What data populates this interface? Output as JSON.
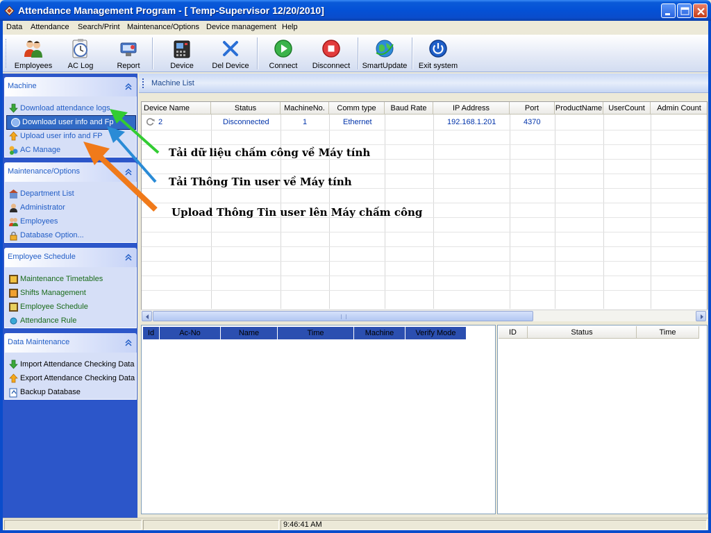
{
  "window": {
    "title": "Attendance Management Program - [ Temp-Supervisor 12/20/2010]",
    "accent": "#0a4ccb"
  },
  "menu": [
    "Data",
    "Attendance",
    "Search/Print",
    "Maintenance/Options",
    "Device management",
    "Help"
  ],
  "toolbar": {
    "employees": "Employees",
    "ac_log": "AC Log",
    "report": "Report",
    "device": "Device",
    "del_device": "Del Device",
    "connect": "Connect",
    "disconnect": "Disconnect",
    "smart_update": "SmartUpdate",
    "exit": "Exit system"
  },
  "sidebar": {
    "machine": {
      "title": "Machine",
      "items": [
        "Download attendance logs",
        "Download user info and Fp",
        "Upload user info and FP",
        "AC Manage"
      ]
    },
    "maintenance": {
      "title": "Maintenance/Options",
      "items": [
        "Department List",
        "Administrator",
        "Employees",
        "Database Option..."
      ]
    },
    "schedule": {
      "title": "Employee Schedule",
      "items": [
        "Maintenance Timetables",
        "Shifts Management",
        "Employee Schedule",
        "Attendance Rule"
      ]
    },
    "data_maint": {
      "title": "Data Maintenance",
      "items": [
        "Import Attendance Checking Data",
        "Export Attendance Checking Data",
        "Backup Database"
      ]
    }
  },
  "machine_list": {
    "title": "Machine List",
    "columns": [
      "Device Name",
      "Status",
      "MachineNo.",
      "Comm type",
      "Baud Rate",
      "IP Address",
      "Port",
      "ProductName",
      "UserCount",
      "Admin Count"
    ],
    "rows": [
      {
        "device_name": "2",
        "status": "Disconnected",
        "machine_no": "1",
        "comm_type": "Ethernet",
        "baud_rate": "",
        "ip": "192.168.1.201",
        "port": "4370",
        "product": "",
        "users": "",
        "admins": ""
      }
    ]
  },
  "log_table": {
    "columns": [
      "Id",
      "Ac-No",
      "Name",
      "Time",
      "Machine",
      "Verify Mode"
    ],
    "header_color": "#2b4fb0"
  },
  "status_table": {
    "columns": [
      "ID",
      "Status",
      "Time"
    ]
  },
  "statusbar": {
    "time": "9:46:41 AM"
  },
  "annotations": {
    "green": "Tải dữ liệu chấm công về Máy tính",
    "blue": "Tải Thông Tin user về Máy tính",
    "orange": "Upload Thông Tin user lên Máy chấm công",
    "colors": {
      "green": "#33cc33",
      "blue": "#2a8bd6",
      "orange": "#f07a1a"
    }
  }
}
